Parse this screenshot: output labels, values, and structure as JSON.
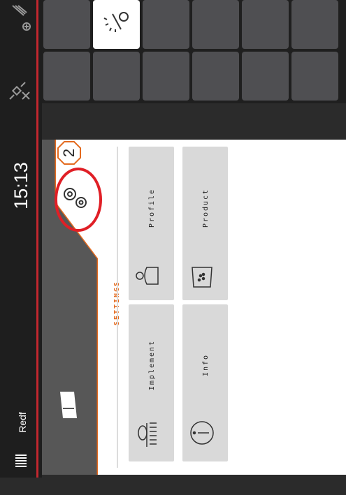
{
  "status": {
    "clock": "15:13",
    "profile_name": "Redf"
  },
  "settings": {
    "title": "SETTINGS",
    "badge_number": "2"
  },
  "menu": {
    "implement_label": "Implement",
    "profile_label": "Profile",
    "info_label": "Info",
    "product_label": "Product"
  },
  "colors": {
    "accent": "#e36a1e",
    "highlight_ring": "#e01f26",
    "tile": "#4f4f52",
    "card": "#d9d9d9"
  },
  "icons": [
    "day-night-icon",
    "gnss-off-icon",
    "gps-icon",
    "logo-icon",
    "settings-gears-icon"
  ]
}
